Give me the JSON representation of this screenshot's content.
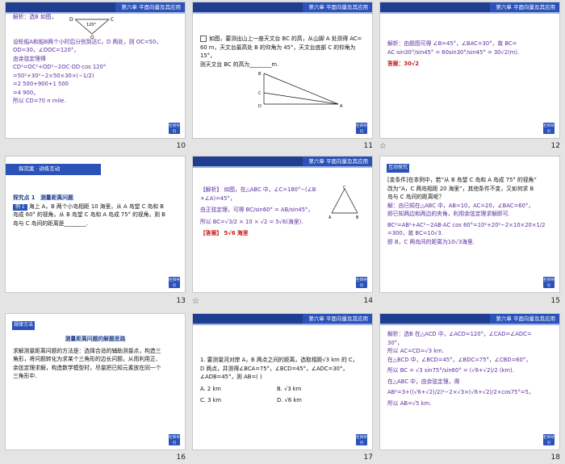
{
  "header_text": "第六章  平面向量及其应用",
  "back_label": "栏目导引",
  "slides": [
    {
      "number": "10",
      "lines": [
        "解析：选B 如图，",
        "设轮船A和船B两个小时后分别到达C，D 两处，则 OC=50，",
        "OD=30，∠DOC=120°，",
        "由余弦定理得",
        "CD²=OC²+OD²−2OC·OD·cos 120°",
        "=50²+30²−2×50×30×(−1/2)",
        "=2 500+900+1 500",
        "=4 900，",
        "所以 CD=70 n mile."
      ],
      "fig_labels": {
        "d": "D",
        "c": "C",
        "angle": "120°",
        "o": "O"
      }
    },
    {
      "number": "11",
      "lines": [
        "如图，要测出山上一座天文台 BC 的高，从山脚 A 处测得 AC=",
        "60 m，天文台最高处 B 的仰角为 45°，天文台底部 C 的仰角为 15°，",
        "则天文台 BC 的高为________m."
      ],
      "fig_labels": {
        "a": "A",
        "b": "B",
        "c": "C",
        "d": "D"
      }
    },
    {
      "number": "12",
      "lines": [
        "解析：由题图可得 ∠B=45°，∠BAC=30°，故 BC=",
        "AC·sin30°/sin45° = 60sin30°/sin45° = 30√2(m).",
        "答案：30√2"
      ]
    },
    {
      "number": "13",
      "banner": "探究案 · 讲练互动",
      "section_title": "测量距离问题",
      "example_tag": "例 1",
      "lines": [
        "海上 A，B 两个小岛相距 10 海里，从 A 岛望 C 岛和 B",
        "岛成 60° 的视角，从 B 岛望 C 岛和 A 岛成 75° 的视角，则 B",
        "岛与 C 岛间的距离是________."
      ],
      "section_label": "探究点 1"
    },
    {
      "number": "14",
      "lines": [
        "【解析】 如图，在△ABC 中，∠C=180°−(∠B",
        "+∠A)=45°，",
        "由正弦定理，可得 BC/sin60° = AB/sin45°，",
        "所以 BC=√3/2 × 10 × √2 = 5√6(海里).",
        "【答案】 5√6 海里"
      ],
      "fig_labels": {
        "a": "A",
        "b": "B",
        "c": "C"
      }
    },
    {
      "number": "15",
      "banner": "互动探究",
      "lines": [
        "[变条件]在本例中，若“从 B 岛望 C 岛和 A 岛成 75° 的视角”",
        "改为“A，C 两岛相距 20 海里”，其他条件不变，又如何求 B",
        "岛与 C 岛间的距离呢？",
        "解：由已知在△ABC 中，AB=10，AC=20，∠BAC=60°，",
        "即已知两边和两边的夹角，利用余弦定理求解即可.",
        "BC²=AB²+AC²−2AB·AC cos 60°=10²+20²−2×10×20×1/2",
        "=300，故 BC=10√3.",
        "即 B，C 两岛间的距离为10√3海里."
      ]
    },
    {
      "number": "16",
      "banner": "规律方法",
      "section_title": "测量距离问题的解题思路",
      "lines": [
        "求解测量距离问题的方法是：选择合适的辅助测量点，构造三",
        "角形，将问题转化为求某个三角形的边长问题，从而利用正、",
        "余弦定理求解，构造数学模型时，尽量把已知元素放在同一个",
        "三角形中."
      ]
    },
    {
      "number": "17",
      "lines": [
        "1. 要测量河对岸 A，B 两点之间的距离，选取相距√3 km 的 C，",
        "D 两点，并测得∠BCA=75°，∠BCD=45°，∠ADC=30°，",
        "∠ADB=45°，则 AB=(    )"
      ],
      "options": [
        "A. 2 km",
        "B. √3 km",
        "C. 3 km",
        "D. √6 km"
      ]
    },
    {
      "number": "18",
      "lines": [
        "解析：选B 在△ACD 中，∠ACD=120°，∠CAD=∠ADC=",
        "30°，",
        "所以 AC=CD=√3 km.",
        "在△BCD 中，∠BCD=45°，∠BDC=75°，∠CBD=60°，",
        "所以 BC = √3 sin75°/sin60° = (√6+√2)/2 (km).",
        "在△ABC 中，由余弦定理，得",
        "AB²=3+((√6+√2)/2)²−2×√3×(√6+√2)/2×cos75°=5，",
        "所以 AB=√5 km."
      ]
    }
  ]
}
